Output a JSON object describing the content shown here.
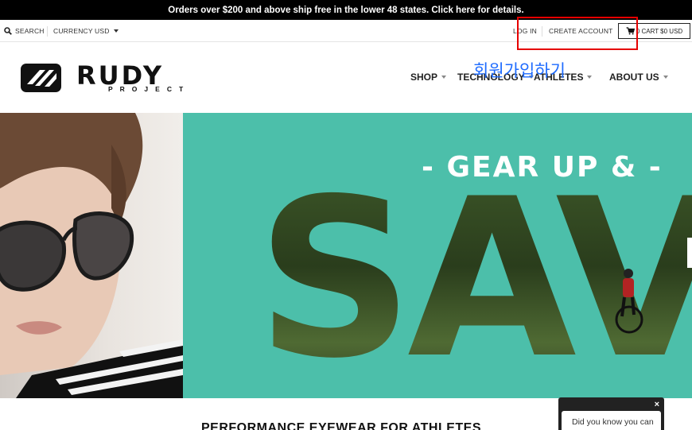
{
  "announcement": "Orders over $200 and above ship free in the lower 48 states. Click here for details.",
  "utility": {
    "search_label": "SEARCH",
    "currency_label": "CURRENCY",
    "currency_value": "USD",
    "login_label": "LOG IN",
    "create_account_label": "CREATE ACCOUNT",
    "cart_label": "0 CART $0 USD"
  },
  "logo": {
    "name": "RUDY",
    "sub": "PROJECT"
  },
  "nav": [
    {
      "label": "SHOP"
    },
    {
      "label": "TECHNOLOGY"
    },
    {
      "label": "ATHLETES"
    },
    {
      "label": "ABOUT US"
    }
  ],
  "annotation": {
    "text": "회원가입하기",
    "color": "#1e6bff",
    "box_color": "#e60000"
  },
  "hero": {
    "kicker": "- GEAR UP & -",
    "word": "SAV",
    "bg_color": "#4cbfaa"
  },
  "section_heading": "PERFORMANCE EYEWEAR FOR ATHLETES",
  "popup": {
    "close_label": "×",
    "text": "Did you know you can"
  },
  "icons": {
    "search": "search-icon",
    "cart": "cart-icon",
    "close": "close-icon"
  }
}
